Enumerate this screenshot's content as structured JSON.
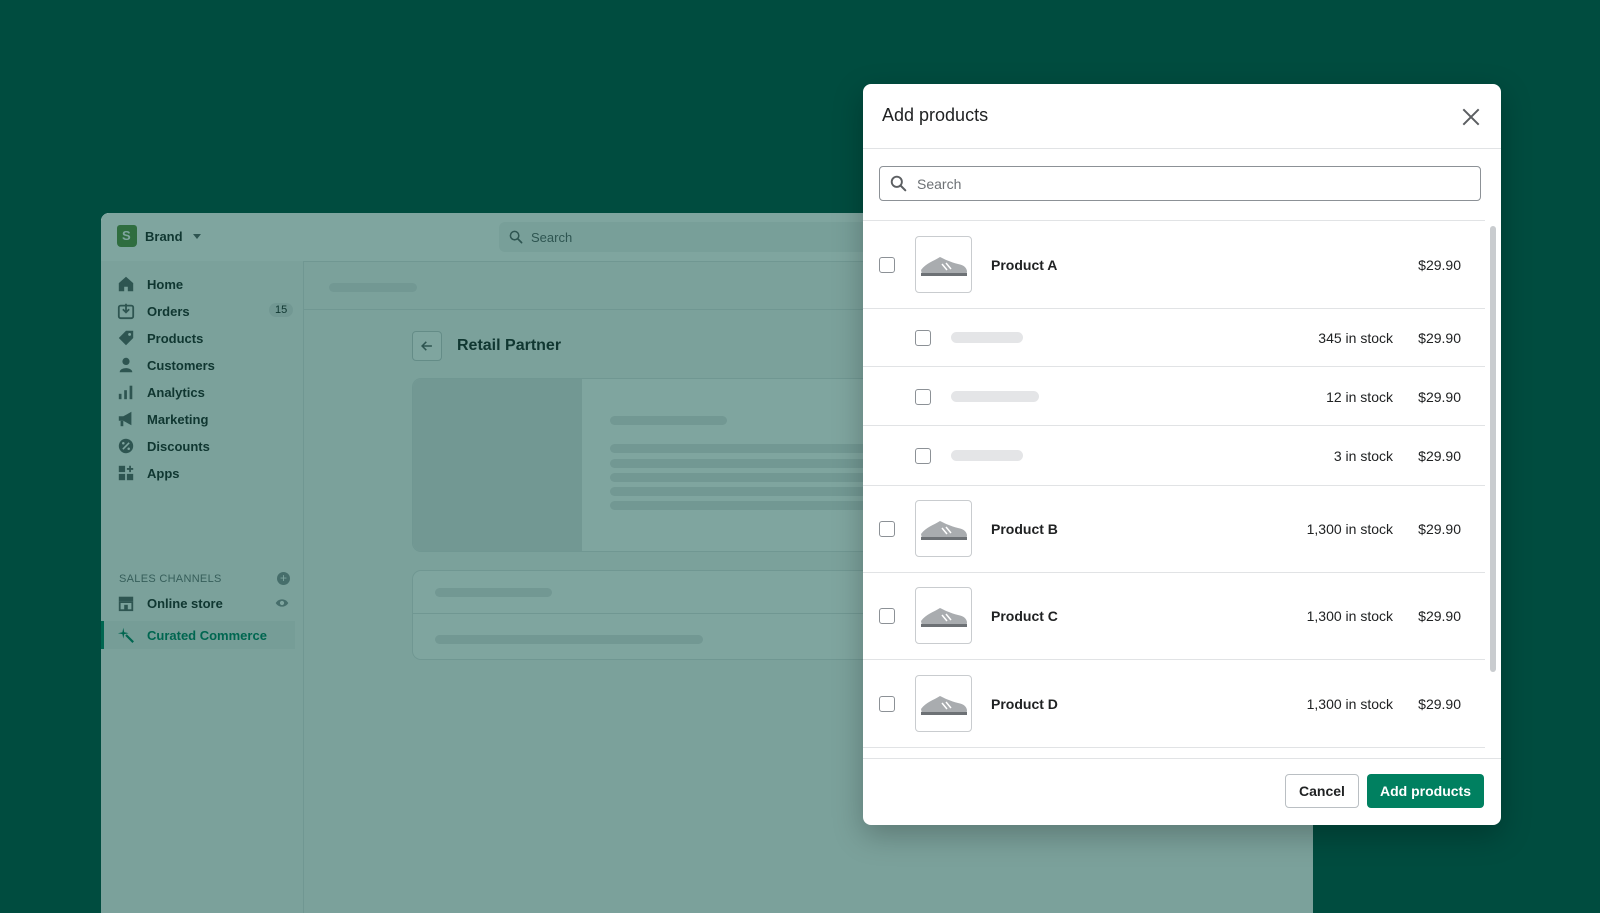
{
  "admin": {
    "brand": "Brand",
    "search_placeholder": "Search",
    "nav": [
      {
        "label": "Home",
        "icon": "home-icon"
      },
      {
        "label": "Orders",
        "icon": "orders-icon",
        "badge": "15"
      },
      {
        "label": "Products",
        "icon": "tag-icon"
      },
      {
        "label": "Customers",
        "icon": "person-icon"
      },
      {
        "label": "Analytics",
        "icon": "bar-chart-icon"
      },
      {
        "label": "Marketing",
        "icon": "megaphone-icon"
      },
      {
        "label": "Discounts",
        "icon": "discount-icon"
      },
      {
        "label": "Apps",
        "icon": "apps-icon"
      }
    ],
    "sales_channels_label": "SALES CHANNELS",
    "channels": [
      {
        "label": "Online store",
        "icon": "store-icon"
      },
      {
        "label": "Curated Commerce",
        "icon": "sparkle-icon"
      }
    ],
    "page_title": "Retail Partner"
  },
  "modal": {
    "title": "Add products",
    "search_placeholder": "Search",
    "products": [
      {
        "name": "Product A",
        "stock": "",
        "price": "$29.90"
      },
      {
        "variant": true,
        "stock": "345 in stock",
        "price": "$29.90"
      },
      {
        "variant": true,
        "stock": "12 in stock",
        "price": "$29.90"
      },
      {
        "variant": true,
        "stock": "3 in stock",
        "price": "$29.90"
      },
      {
        "name": "Product B",
        "stock": "1,300 in stock",
        "price": "$29.90"
      },
      {
        "name": "Product C",
        "stock": "1,300 in stock",
        "price": "$29.90"
      },
      {
        "name": "Product D",
        "stock": "1,300 in stock",
        "price": "$29.90"
      }
    ],
    "cancel_label": "Cancel",
    "add_label": "Add products"
  },
  "colors": {
    "background": "#004c3f",
    "primary": "#008060",
    "brand_green": "#5e8e3e"
  }
}
